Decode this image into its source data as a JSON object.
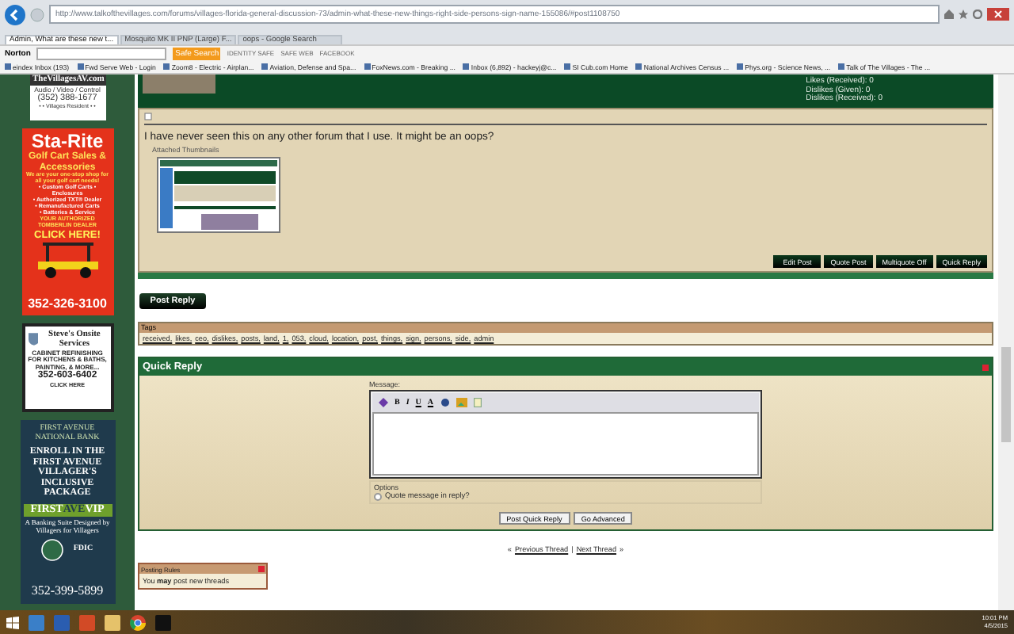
{
  "browser": {
    "url": "http://www.talkofthevillages.com/forums/villages-florida-general-discussion-73/admin-what-these-new-things-right-side-persons-sign-name-155086/#post1108750",
    "tabs": [
      {
        "label": "Admin, What are these new t...",
        "selected": true
      },
      {
        "label": "Mosquito MK II PNP (Large) F...",
        "selected": false
      },
      {
        "label": "oops - Google Search",
        "selected": false
      }
    ],
    "norton": {
      "brand": "Norton",
      "search_button": "Safe Search",
      "items": [
        "IDENTITY SAFE",
        "SAFE WEB",
        "FACEBOOK"
      ]
    },
    "favorites": [
      "eindex Inbox (193)",
      "Fwd Serve Web - Login",
      "Zoom8 - Electric - Airplan...",
      "Aviation, Defense and Spa...",
      "FoxNews.com - Breaking ...",
      "Inbox (6,892) - hackeyj@c...",
      "SI Cub.com Home",
      "National Archives Census ...",
      "Phys.org - Science News, ...",
      "Talk of The Villages - The ..."
    ]
  },
  "sidebar": {
    "ad_av": {
      "site": "TheVillagesAV.com",
      "tagline": "Audio / Video / Control",
      "phone": "(352) 388-1677",
      "note": "• • Villages Resident • •"
    },
    "ad_starite": {
      "brand": "Sta-Rite",
      "title": "Golf Cart Sales & Accessories",
      "intro": "We are your one-stop shop for all your golf cart needs!",
      "features": [
        "• Custom Golf Carts • Enclosures",
        "• Authorized TXT® Dealer",
        "• Remanufactured Carts",
        "• Batteries & Service"
      ],
      "dealer": "YOUR AUTHORIZED TOMBERLIN DEALER",
      "cta": "CLICK HERE!",
      "phone": "352-326-3100"
    },
    "ad_steves": {
      "name": "Steve's Onsite Services",
      "services": "CABINET REFINISHING FOR KITCHENS & BATHS, PAINTING, & MORE...",
      "phone": "352-603-6402",
      "cta": "CLICK HERE"
    },
    "ad_bank": {
      "bank": "FIRST AVENUE NATIONAL BANK",
      "headline": "ENROLL IN THE FIRST AVENUE VILLAGER'S INCLUSIVE PACKAGE",
      "vip_first": "FIRST",
      "vip_ave": "AVE",
      "vip_last": "VIP",
      "slogan": "A Banking Suite Designed by Villagers for Villagers",
      "badge": "FDIC",
      "phone": "352-399-5899"
    }
  },
  "post": {
    "stats": [
      "Likes (Received): 0",
      "Dislikes (Given): 0",
      "Dislikes (Received): 0"
    ],
    "message": "I have never seen this on any other forum that I use. It might be an oops?",
    "attachments_label": "Attached Thumbnails",
    "buttons": [
      "Edit Post",
      "Quote Post",
      "Multiquote Off",
      "Quick Reply"
    ]
  },
  "post_reply_button": "Post Reply",
  "tags": {
    "title": "Tags",
    "items": [
      "received,",
      "likes,",
      "ceo,",
      "dislikes,",
      "posts,",
      "land,",
      "1,",
      "053,",
      "cloud,",
      "location,",
      "post,",
      "things,",
      "sign,",
      "persons,",
      "side,",
      "admin"
    ]
  },
  "quick_reply": {
    "title": "Quick Reply",
    "message_label": "Message:",
    "editor_buttons": [
      "B",
      "I",
      "U",
      "A"
    ],
    "options_label": "Options",
    "quote_option": {
      "label": "Quote message in reply?",
      "checked": false
    },
    "buttons": [
      "Post Quick Reply",
      "Go Advanced"
    ]
  },
  "thread_nav": {
    "prev_mark": "«",
    "previous": "Previous Thread",
    "separator": "|",
    "next": "Next Thread",
    "next_mark": "»"
  },
  "posting_rules": {
    "title": "Posting Rules",
    "text": "You **may** post new threads"
  },
  "taskbar": {
    "time": "10:01 PM",
    "date": "4/5/2015"
  }
}
